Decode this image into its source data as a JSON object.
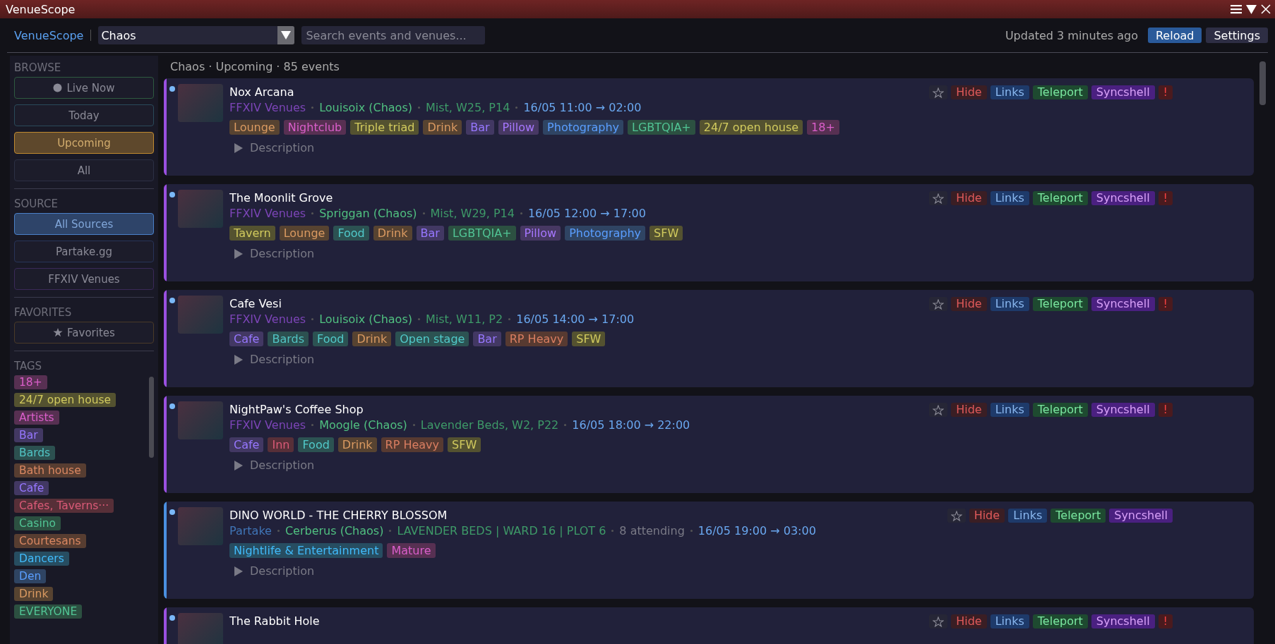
{
  "window": {
    "title": "VenueScope"
  },
  "toolbar": {
    "brand": "VenueScope",
    "datacenter": "Chaos",
    "search": {
      "placeholder": "Search events and venues..."
    },
    "updated": "Updated 3 minutes ago",
    "buttons": [
      {
        "label": "Reload",
        "kind": "primary"
      },
      {
        "label": "Settings",
        "kind": "secondary"
      }
    ]
  },
  "sidebar": {
    "sections": [
      {
        "title": "BROWSE",
        "items": [
          {
            "label": "Live Now",
            "kind": "live",
            "selected": false,
            "color": "#2e5a40"
          },
          {
            "label": "Today",
            "kind": "plain",
            "selected": false,
            "color": "#2a4a5a"
          },
          {
            "label": "Upcoming",
            "kind": "plain",
            "selected": true,
            "color": "#c08a30"
          },
          {
            "label": "All",
            "kind": "plain",
            "selected": false,
            "color": "#2c3044"
          }
        ]
      },
      {
        "title": "SOURCE",
        "items": [
          {
            "label": "All Sources",
            "kind": "plain",
            "selected": true,
            "color": "#4a80c8"
          },
          {
            "label": "Partake.gg",
            "kind": "plain",
            "selected": false,
            "color": "#283458"
          },
          {
            "label": "FFXIV Venues",
            "kind": "plain",
            "selected": false,
            "color": "#3a2a58"
          }
        ]
      },
      {
        "title": "FAVORITES",
        "items": [
          {
            "label": "Favorites",
            "kind": "favorites",
            "selected": false,
            "color": "#4a3a28"
          }
        ]
      }
    ],
    "tags_title": "TAGS",
    "tags": [
      {
        "label": "18+",
        "color": "#573052"
      },
      {
        "label": "24/7 open house",
        "color": "#545230"
      },
      {
        "label": "Artists",
        "color": "#573052"
      },
      {
        "label": "Bar",
        "color": "#423863"
      },
      {
        "label": "Bards",
        "color": "#2c5050"
      },
      {
        "label": "Bath house",
        "color": "#573d31"
      },
      {
        "label": "Cafe",
        "color": "#423863"
      },
      {
        "label": "Cafes, Taverns···",
        "color": "#572f38"
      },
      {
        "label": "Casino",
        "color": "#2c5041"
      },
      {
        "label": "Courtesans",
        "color": "#573d31"
      },
      {
        "label": "Dancers",
        "color": "#274d61"
      },
      {
        "label": "Den",
        "color": "#2f4463"
      },
      {
        "label": "Drink",
        "color": "#574331"
      },
      {
        "label": "EVERYONE",
        "color": "#2c5041"
      }
    ]
  },
  "list_header": "Chaos · Upcoming · 85 events",
  "events": [
    {
      "title": "Nox Arcana",
      "color": "#9a50e0",
      "meta": [
        {
          "kind": "source",
          "text": "FFXIV Venues"
        },
        {
          "kind": "world",
          "text": "Louisoix (Chaos)"
        },
        {
          "kind": "location",
          "text": "Mist, W25, P14"
        },
        {
          "kind": "time",
          "text": "16/05 11:00 → 02:00"
        }
      ],
      "tags": [
        {
          "label": "Lounge",
          "color": "#574331"
        },
        {
          "label": "Nightclub",
          "color": "#573052"
        },
        {
          "label": "Triple triad",
          "color": "#545230"
        },
        {
          "label": "Drink",
          "color": "#574331"
        },
        {
          "label": "Bar",
          "color": "#423863"
        },
        {
          "label": "Pillow",
          "color": "#473863"
        },
        {
          "label": "Photography",
          "color": "#2f4463"
        },
        {
          "label": "LGBTQIA+",
          "color": "#2c5041"
        },
        {
          "label": "24/7 open house",
          "color": "#545230"
        },
        {
          "label": "18+",
          "color": "#573052"
        }
      ],
      "description": {
        "label": "Description",
        "expanded": false
      },
      "actions": [
        {
          "label": "Hide",
          "kind": "hide"
        },
        {
          "label": "Links",
          "kind": "links"
        },
        {
          "label": "Teleport",
          "kind": "teleport"
        },
        {
          "label": "Syncshell",
          "kind": "syncshell"
        },
        {
          "label": "!",
          "kind": "report"
        }
      ]
    },
    {
      "title": "The Moonlit Grove",
      "color": "#9a50e0",
      "meta": [
        {
          "kind": "source",
          "text": "FFXIV Venues"
        },
        {
          "kind": "world",
          "text": "Spriggan (Chaos)"
        },
        {
          "kind": "location",
          "text": "Mist, W29, P14"
        },
        {
          "kind": "time",
          "text": "16/05 12:00 → 17:00"
        }
      ],
      "tags": [
        {
          "label": "Tavern",
          "color": "#545230"
        },
        {
          "label": "Lounge",
          "color": "#574331"
        },
        {
          "label": "Food",
          "color": "#2c5252"
        },
        {
          "label": "Drink",
          "color": "#574331"
        },
        {
          "label": "Bar",
          "color": "#423863"
        },
        {
          "label": "LGBTQIA+",
          "color": "#2c5041"
        },
        {
          "label": "Pillow",
          "color": "#473863"
        },
        {
          "label": "Photography",
          "color": "#2f4463"
        },
        {
          "label": "SFW",
          "color": "#545230"
        }
      ],
      "description": {
        "label": "Description",
        "expanded": false
      },
      "actions": [
        {
          "label": "Hide",
          "kind": "hide"
        },
        {
          "label": "Links",
          "kind": "links"
        },
        {
          "label": "Teleport",
          "kind": "teleport"
        },
        {
          "label": "Syncshell",
          "kind": "syncshell"
        },
        {
          "label": "!",
          "kind": "report"
        }
      ]
    },
    {
      "title": "Cafe Vesi",
      "color": "#9a50e0",
      "meta": [
        {
          "kind": "source",
          "text": "FFXIV Venues"
        },
        {
          "kind": "world",
          "text": "Louisoix (Chaos)"
        },
        {
          "kind": "location",
          "text": "Mist, W11, P2"
        },
        {
          "kind": "time",
          "text": "16/05 14:00 → 17:00"
        }
      ],
      "tags": [
        {
          "label": "Cafe",
          "color": "#423863"
        },
        {
          "label": "Bards",
          "color": "#2c5050"
        },
        {
          "label": "Food",
          "color": "#2c5252"
        },
        {
          "label": "Drink",
          "color": "#574331"
        },
        {
          "label": "Open stage",
          "color": "#2c5252"
        },
        {
          "label": "Bar",
          "color": "#423863"
        },
        {
          "label": "RP Heavy",
          "color": "#573a31"
        },
        {
          "label": "SFW",
          "color": "#545230"
        }
      ],
      "description": {
        "label": "Description",
        "expanded": false
      },
      "actions": [
        {
          "label": "Hide",
          "kind": "hide"
        },
        {
          "label": "Links",
          "kind": "links"
        },
        {
          "label": "Teleport",
          "kind": "teleport"
        },
        {
          "label": "Syncshell",
          "kind": "syncshell"
        },
        {
          "label": "!",
          "kind": "report"
        }
      ]
    },
    {
      "title": "NightPaw's Coffee Shop",
      "color": "#9a50e0",
      "meta": [
        {
          "kind": "source",
          "text": "FFXIV Venues"
        },
        {
          "kind": "world",
          "text": "Moogle (Chaos)"
        },
        {
          "kind": "location",
          "text": "Lavender Beds, W2, P22"
        },
        {
          "kind": "time",
          "text": "16/05 18:00 → 22:00"
        }
      ],
      "tags": [
        {
          "label": "Cafe",
          "color": "#423863"
        },
        {
          "label": "Inn",
          "color": "#572f38"
        },
        {
          "label": "Food",
          "color": "#2c5252"
        },
        {
          "label": "Drink",
          "color": "#574331"
        },
        {
          "label": "RP Heavy",
          "color": "#573a31"
        },
        {
          "label": "SFW",
          "color": "#545230"
        }
      ],
      "description": {
        "label": "Description",
        "expanded": false
      },
      "actions": [
        {
          "label": "Hide",
          "kind": "hide"
        },
        {
          "label": "Links",
          "kind": "links"
        },
        {
          "label": "Teleport",
          "kind": "teleport"
        },
        {
          "label": "Syncshell",
          "kind": "syncshell"
        },
        {
          "label": "!",
          "kind": "report"
        }
      ]
    },
    {
      "title": "DINO WORLD - THE CHERRY BLOSSOM",
      "color": "#4a90e0",
      "meta": [
        {
          "kind": "source",
          "text": "Partake"
        },
        {
          "kind": "world",
          "text": "Cerberus (Chaos)"
        },
        {
          "kind": "location",
          "text": "LAVENDER BEDS | WARD 16 | PLOT 6"
        },
        {
          "kind": "attending",
          "text": "8 attending"
        },
        {
          "kind": "time",
          "text": "16/05 19:00 → 03:00"
        }
      ],
      "tags": [
        {
          "label": "Nightlife & Entertainment",
          "color": "#274d61"
        },
        {
          "label": "Mature",
          "color": "#573052"
        }
      ],
      "description": {
        "label": "Description",
        "expanded": false
      },
      "actions": [
        {
          "label": "Hide",
          "kind": "hide"
        },
        {
          "label": "Links",
          "kind": "links"
        },
        {
          "label": "Teleport",
          "kind": "teleport"
        },
        {
          "label": "Syncshell",
          "kind": "syncshell"
        }
      ]
    },
    {
      "title": "The Rabbit Hole",
      "color": "#9a50e0",
      "actions": [
        {
          "label": "Hide",
          "kind": "hide"
        },
        {
          "label": "Links",
          "kind": "links"
        },
        {
          "label": "Teleport",
          "kind": "teleport"
        },
        {
          "label": "Syncshell",
          "kind": "syncshell"
        },
        {
          "label": "!",
          "kind": "report"
        }
      ]
    }
  ]
}
